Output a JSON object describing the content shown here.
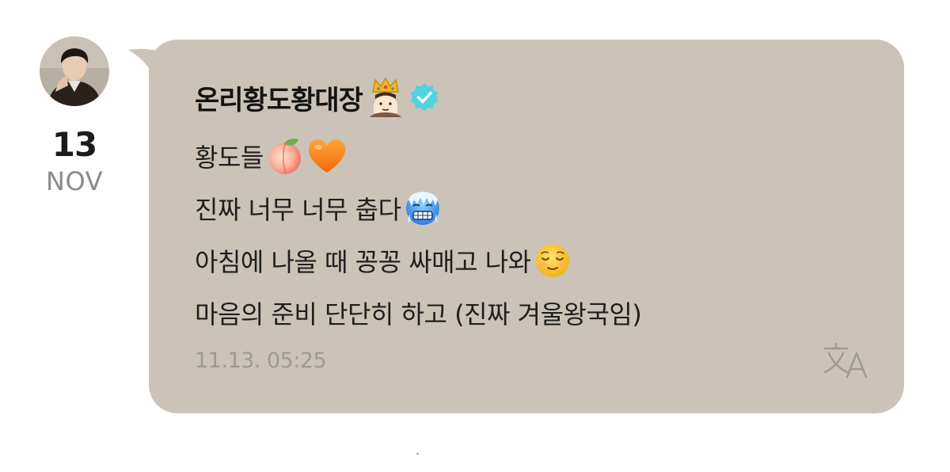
{
  "date": {
    "day": "13",
    "month": "NOV"
  },
  "sender": {
    "name": "온리황도황대장",
    "verified": true
  },
  "message": {
    "lines": [
      "황도들",
      "진짜 너무 너무 춥다",
      "아침에 나올 때 꽁꽁 싸매고 나와",
      "마음의 준비 단단히 하고 (진짜 겨울왕국임)"
    ]
  },
  "timestamp": "11.13. 05:25",
  "icons": {
    "sender": [
      "crown-prince-emoji",
      "verified-badge-icon"
    ],
    "line1": [
      "peach-emoji",
      "orange-heart-emoji"
    ],
    "line2": [
      "cold-face-emoji"
    ],
    "line3": [
      "relieved-face-emoji"
    ],
    "translate": "translate-icon"
  },
  "colors": {
    "bubble": "#cbc3b8",
    "verified": "#4fd3de",
    "timestamp": "#9f998f",
    "month": "#8b8b8b"
  }
}
